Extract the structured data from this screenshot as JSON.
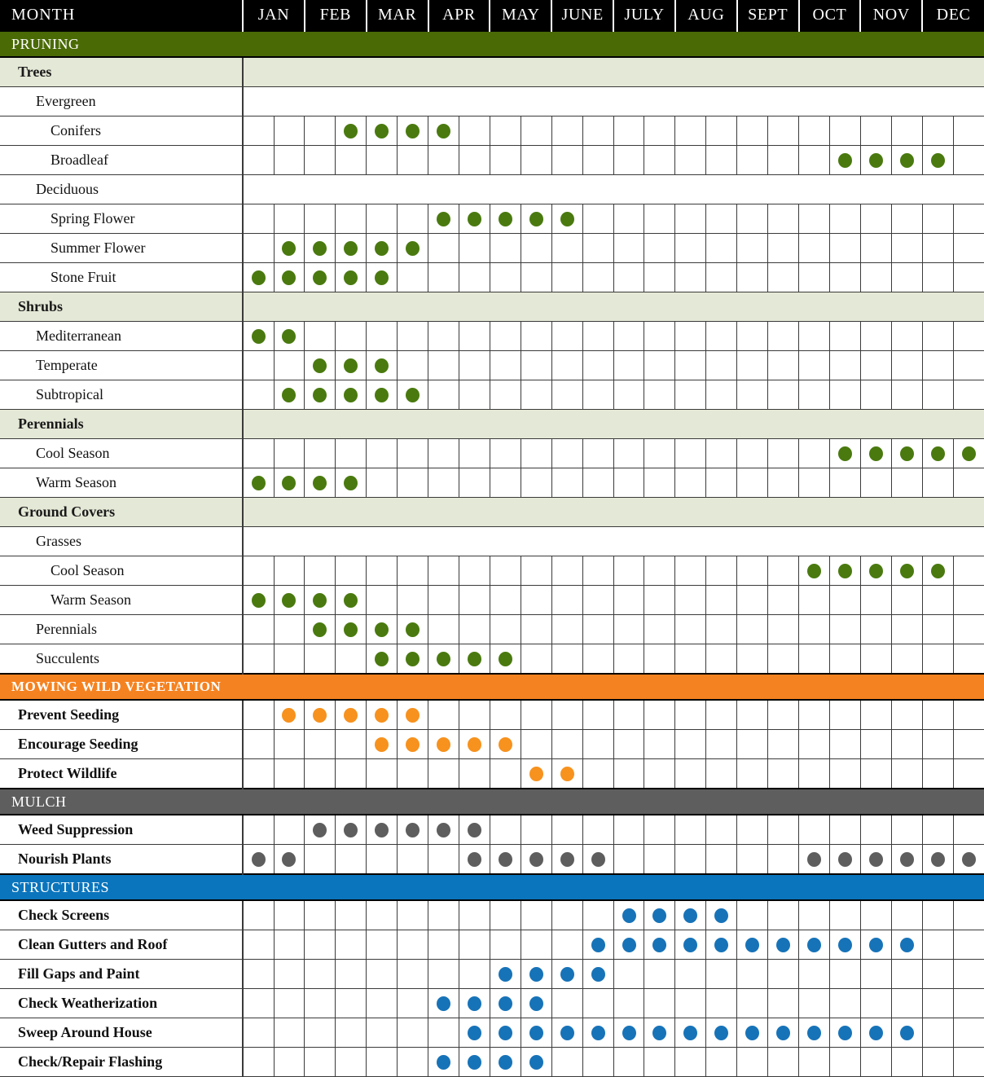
{
  "header": {
    "row_label": "MONTH",
    "months": [
      "JAN",
      "FEB",
      "MAR",
      "APR",
      "MAY",
      "JUNE",
      "JULY",
      "AUG",
      "SEPT",
      "OCT",
      "NOV",
      "DEC"
    ]
  },
  "colors": {
    "pruning": "#4a6a06",
    "mowing": "#f58220",
    "mulch": "#5e5e5e",
    "structures": "#0a75bd",
    "group_band": "#e4e8d6",
    "dot_green": "#4a7a0f",
    "dot_orange": "#f7921e",
    "dot_gray": "#5e5e5e",
    "dot_blue": "#1773b8",
    "header_bg": "#000000",
    "header_text": "#ffffff"
  },
  "chart_data": {
    "type": "heatmap",
    "title": "MONTH",
    "xlabel": "",
    "ylabel": "",
    "x": [
      "JAN",
      "FEB",
      "MAR",
      "APR",
      "MAY",
      "JUNE",
      "JULY",
      "AUG",
      "SEPT",
      "OCT",
      "NOV",
      "DEC"
    ],
    "columns_per_month": 2,
    "total_columns": 24,
    "legend": [
      {
        "label": "PRUNING",
        "color": "#4a7a0f"
      },
      {
        "label": "MOWING WILD VEGETATION",
        "color": "#f7921e"
      },
      {
        "label": "MULCH",
        "color": "#5e5e5e"
      },
      {
        "label": "STRUCTURES",
        "color": "#1773b8"
      }
    ],
    "sections": [
      {
        "title": "PRUNING",
        "color_key": "green",
        "dot_class": "g",
        "rows": [
          {
            "label": "Trees",
            "kind": "group",
            "indent": 0,
            "marks": []
          },
          {
            "label": "Evergreen",
            "kind": "blank",
            "indent": 1,
            "marks": []
          },
          {
            "label": "Conifers",
            "kind": "data",
            "indent": 2,
            "marks": [
              3,
              4,
              5,
              6
            ]
          },
          {
            "label": "Broadleaf",
            "kind": "data",
            "indent": 2,
            "marks": [
              19,
              20,
              21,
              22
            ]
          },
          {
            "label": "Deciduous",
            "kind": "blank",
            "indent": 1,
            "marks": []
          },
          {
            "label": "Spring Flower",
            "kind": "data",
            "indent": 2,
            "marks": [
              6,
              7,
              8,
              9,
              10
            ]
          },
          {
            "label": "Summer Flower",
            "kind": "data",
            "indent": 2,
            "marks": [
              1,
              2,
              3,
              4,
              5
            ]
          },
          {
            "label": "Stone Fruit",
            "kind": "data",
            "indent": 2,
            "marks": [
              0,
              1,
              2,
              3,
              4
            ]
          },
          {
            "label": "Shrubs",
            "kind": "group",
            "indent": 0,
            "marks": []
          },
          {
            "label": "Mediterranean",
            "kind": "data",
            "indent": 1,
            "marks": [
              0,
              1
            ]
          },
          {
            "label": "Temperate",
            "kind": "data",
            "indent": 1,
            "marks": [
              2,
              3,
              4
            ]
          },
          {
            "label": "Subtropical",
            "kind": "data",
            "indent": 1,
            "marks": [
              1,
              2,
              3,
              4,
              5
            ]
          },
          {
            "label": "Perennials",
            "kind": "group",
            "indent": 0,
            "marks": []
          },
          {
            "label": "Cool Season",
            "kind": "data",
            "indent": 1,
            "marks": [
              19,
              20,
              21,
              22,
              23
            ]
          },
          {
            "label": "Warm Season",
            "kind": "data",
            "indent": 1,
            "marks": [
              0,
              1,
              2,
              3
            ]
          },
          {
            "label": "Ground Covers",
            "kind": "group",
            "indent": 0,
            "marks": []
          },
          {
            "label": "Grasses",
            "kind": "blank",
            "indent": 1,
            "marks": []
          },
          {
            "label": "Cool Season",
            "kind": "data",
            "indent": 2,
            "marks": [
              18,
              19,
              20,
              21,
              22
            ]
          },
          {
            "label": "Warm Season",
            "kind": "data",
            "indent": 2,
            "marks": [
              0,
              1,
              2,
              3
            ]
          },
          {
            "label": "Perennials",
            "kind": "data",
            "indent": 1,
            "marks": [
              2,
              3,
              4,
              5
            ]
          },
          {
            "label": "Succulents",
            "kind": "data",
            "indent": 1,
            "marks": [
              4,
              5,
              6,
              7,
              8
            ]
          }
        ]
      },
      {
        "title": "MOWING WILD VEGETATION",
        "color_key": "orange",
        "dot_class": "o",
        "rows": [
          {
            "label": "Prevent Seeding",
            "kind": "data",
            "indent": 0,
            "marks": [
              1,
              2,
              3,
              4,
              5
            ]
          },
          {
            "label": "Encourage Seeding",
            "kind": "data",
            "indent": 0,
            "marks": [
              4,
              5,
              6,
              7,
              8
            ]
          },
          {
            "label": "Protect Wildlife",
            "kind": "data",
            "indent": 0,
            "marks": [
              9,
              10
            ]
          }
        ]
      },
      {
        "title": "MULCH",
        "color_key": "gray",
        "dot_class": "s",
        "rows": [
          {
            "label": "Weed Suppression",
            "kind": "data",
            "indent": 0,
            "marks": [
              2,
              3,
              4,
              5,
              6,
              7
            ]
          },
          {
            "label": "Nourish Plants",
            "kind": "data",
            "indent": 0,
            "marks": [
              0,
              1,
              7,
              8,
              9,
              10,
              11,
              18,
              19,
              20,
              21,
              22,
              23
            ]
          }
        ]
      },
      {
        "title": "STRUCTURES",
        "color_key": "blue",
        "dot_class": "b",
        "rows": [
          {
            "label": "Check Screens",
            "kind": "data",
            "indent": 0,
            "marks": [
              12,
              13,
              14,
              15
            ]
          },
          {
            "label": "Clean Gutters and Roof",
            "kind": "data",
            "indent": 0,
            "marks": [
              11,
              12,
              13,
              14,
              15,
              16,
              17,
              18,
              19,
              20,
              21
            ]
          },
          {
            "label": "Fill Gaps and Paint",
            "kind": "data",
            "indent": 0,
            "marks": [
              8,
              9,
              10,
              11
            ]
          },
          {
            "label": "Check Weatherization",
            "kind": "data",
            "indent": 0,
            "marks": [
              6,
              7,
              8,
              9
            ]
          },
          {
            "label": "Sweep Around House",
            "kind": "data",
            "indent": 0,
            "marks": [
              7,
              8,
              9,
              10,
              11,
              12,
              13,
              14,
              15,
              16,
              17,
              18,
              19,
              20,
              21
            ]
          },
          {
            "label": "Check/Repair Flashing",
            "kind": "data",
            "indent": 0,
            "marks": [
              6,
              7,
              8,
              9
            ]
          }
        ]
      }
    ]
  }
}
